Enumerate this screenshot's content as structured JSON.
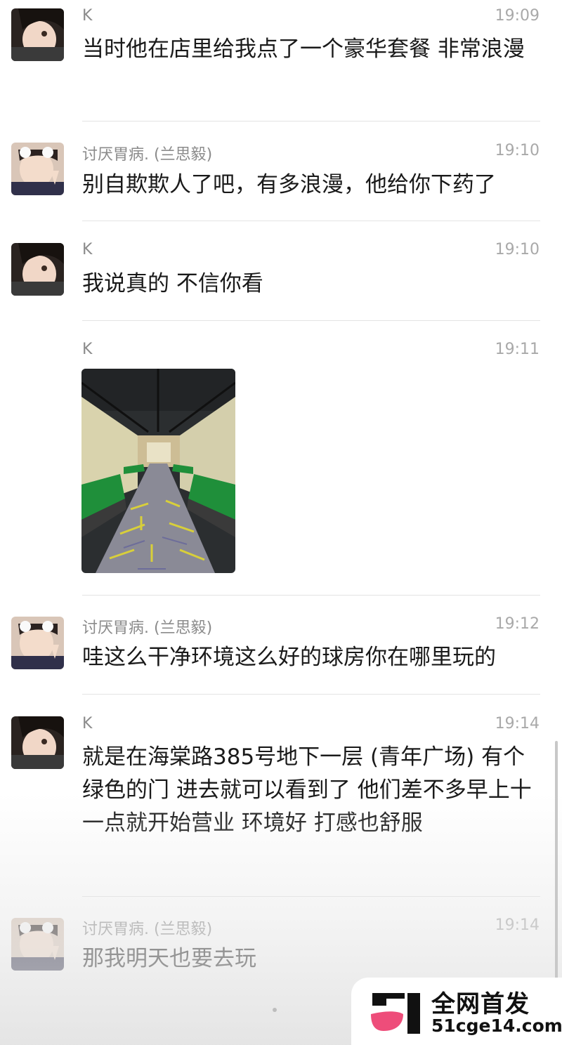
{
  "messages": [
    {
      "sender": "K",
      "time": "19:09",
      "text": "当时他在店里给我点了一个豪华套餐 非常浪漫"
    },
    {
      "sender": "讨厌胃病. (兰思毅)",
      "time": "19:10",
      "text": "别自欺欺人了吧，有多浪漫，他给你下药了"
    },
    {
      "sender": "K",
      "time": "19:10",
      "text": "我说真的 不信你看"
    },
    {
      "sender": "K",
      "time": "19:11",
      "image": "billiard-room-photo"
    },
    {
      "sender": "讨厌胃病. (兰思毅)",
      "time": "19:12",
      "text": "哇这么干净环境这么好的球房你在哪里玩的"
    },
    {
      "sender": "K",
      "time": "19:14",
      "text": "就是在海棠路385号地下一层 (青年广场) 有个绿色的门 进去就可以看到了 他们差不多早上十一点就开始营业 环境好 打感也舒服"
    },
    {
      "sender": "讨厌胃病. (兰思毅)",
      "time": "19:14",
      "text": "那我明天也要去玩"
    }
  ],
  "watermark": {
    "title": "全网首发",
    "site": "51cge14.com"
  },
  "colors": {
    "table_felt": "#1f8f3a",
    "watermark_pink": "#ee4d7a"
  }
}
